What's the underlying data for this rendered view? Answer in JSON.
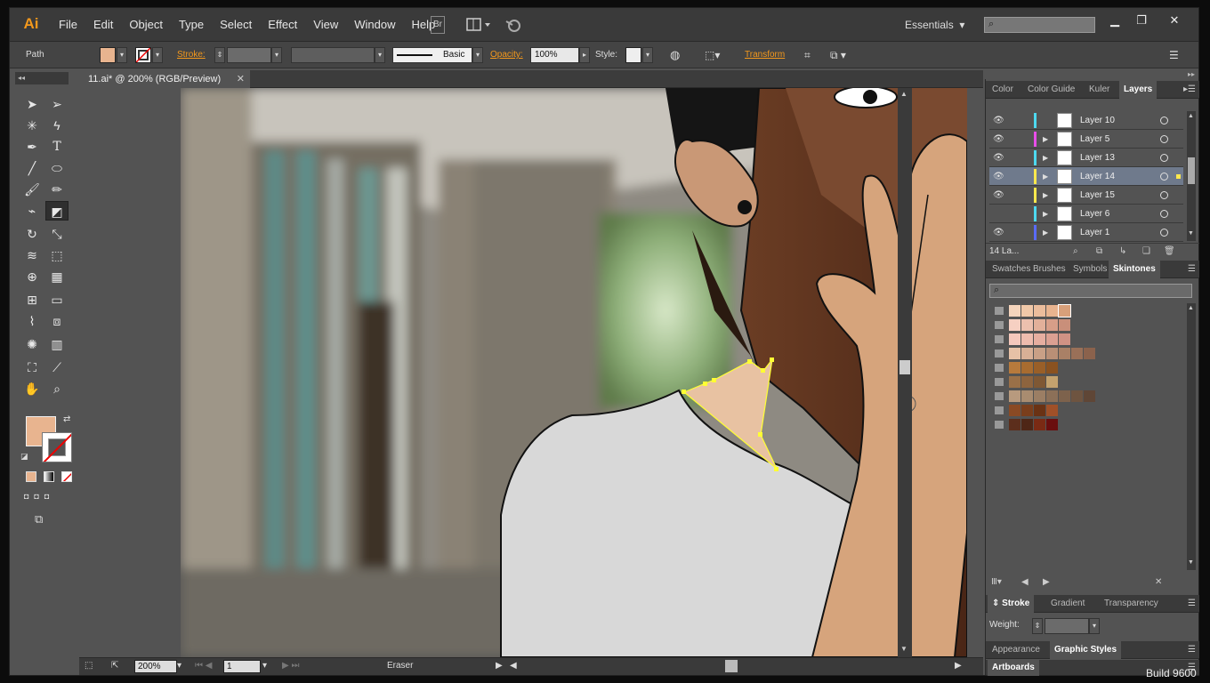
{
  "app": {
    "logo": "Ai",
    "menu": [
      "File",
      "Edit",
      "Object",
      "Type",
      "Select",
      "Effect",
      "View",
      "Window",
      "Help"
    ],
    "bridge_label": "Br",
    "workspace": "Essentials",
    "window_controls": [
      "minimize-icon",
      "restore-icon",
      "close-icon"
    ]
  },
  "control": {
    "selection_type": "Path",
    "stroke_label": "Stroke:",
    "brush_label": "Basic",
    "opacity_label": "Opacity:",
    "opacity_value": "100%",
    "style_label": "Style:",
    "transform_label": "Transform",
    "fill_color": "#e8b48f"
  },
  "document": {
    "tab_title": "11.ai* @ 200% (RGB/Preview)"
  },
  "status": {
    "zoom": "200%",
    "artboard": "1",
    "tool_name": "Eraser"
  },
  "layers_panel": {
    "tabs": [
      "Color",
      "Color Guide",
      "Kuler",
      "Layers"
    ],
    "active_tab": "Layers",
    "layers": [
      {
        "name": "Layer 10",
        "color": "#4dd9f0",
        "expandable": false,
        "visible": true,
        "selected": false
      },
      {
        "name": "Layer 5",
        "color": "#e84de8",
        "expandable": true,
        "visible": true,
        "selected": false
      },
      {
        "name": "Layer 13",
        "color": "#4dd9f0",
        "expandable": true,
        "visible": true,
        "selected": false
      },
      {
        "name": "Layer 14",
        "color": "#ffe84d",
        "expandable": true,
        "visible": true,
        "selected": true
      },
      {
        "name": "Layer 15",
        "color": "#ffe84d",
        "expandable": true,
        "visible": true,
        "selected": false
      },
      {
        "name": "Layer 6",
        "color": "#4dd9f0",
        "expandable": true,
        "visible": false,
        "selected": false
      },
      {
        "name": "Layer 1",
        "color": "#5a6bff",
        "expandable": true,
        "visible": true,
        "selected": false
      }
    ],
    "count_label": "14 La..."
  },
  "swatches_panel": {
    "tabs": [
      "Swatches",
      "Brushes",
      "Symbols",
      "Skintones"
    ],
    "active_tab": "Skintones",
    "rows": [
      [
        "#f4d4bc",
        "#f0c8a8",
        "#ebbd9c",
        "#e8b48f",
        "#d8a07a"
      ],
      [
        "#f6d0c2",
        "#ecc0ae",
        "#e2b09a",
        "#d79e88",
        "#c98f7a"
      ],
      [
        "#f5c8bc",
        "#eebcae",
        "#e6aea0",
        "#dba092",
        "#d09284"
      ],
      [
        "#e7c1a6",
        "#d8b096",
        "#c9a086",
        "#b98f76",
        "#a98066",
        "#9a7058",
        "#8b624c"
      ],
      [
        "#b77a3c",
        "#a86c30",
        "#995f28",
        "#8a5220"
      ],
      [
        "#9a7048",
        "#8e643e",
        "#7f5834",
        "#c4a26e"
      ],
      [
        "#b89a7e",
        "#a98c70",
        "#9b7e64",
        "#8c7058",
        "#7d624c",
        "#6e5440",
        "#5f4636"
      ],
      [
        "#8a4a24",
        "#7a3e1c",
        "#6a3214",
        "#a05028"
      ],
      [
        "#5c2e1c",
        "#4e2616",
        "#7a2a14",
        "#6a0e0e"
      ]
    ]
  },
  "stroke_panel": {
    "tabs": [
      "Stroke",
      "Gradient",
      "Transparency"
    ],
    "active_tab": "Stroke",
    "weight_label": "Weight:"
  },
  "appearance_panel": {
    "tabs": [
      "Appearance",
      "Graphic Styles"
    ],
    "active_tab": "Graphic Styles"
  },
  "artboards_panel": {
    "title": "Artboards"
  },
  "taskbar_text": "Build 9600"
}
